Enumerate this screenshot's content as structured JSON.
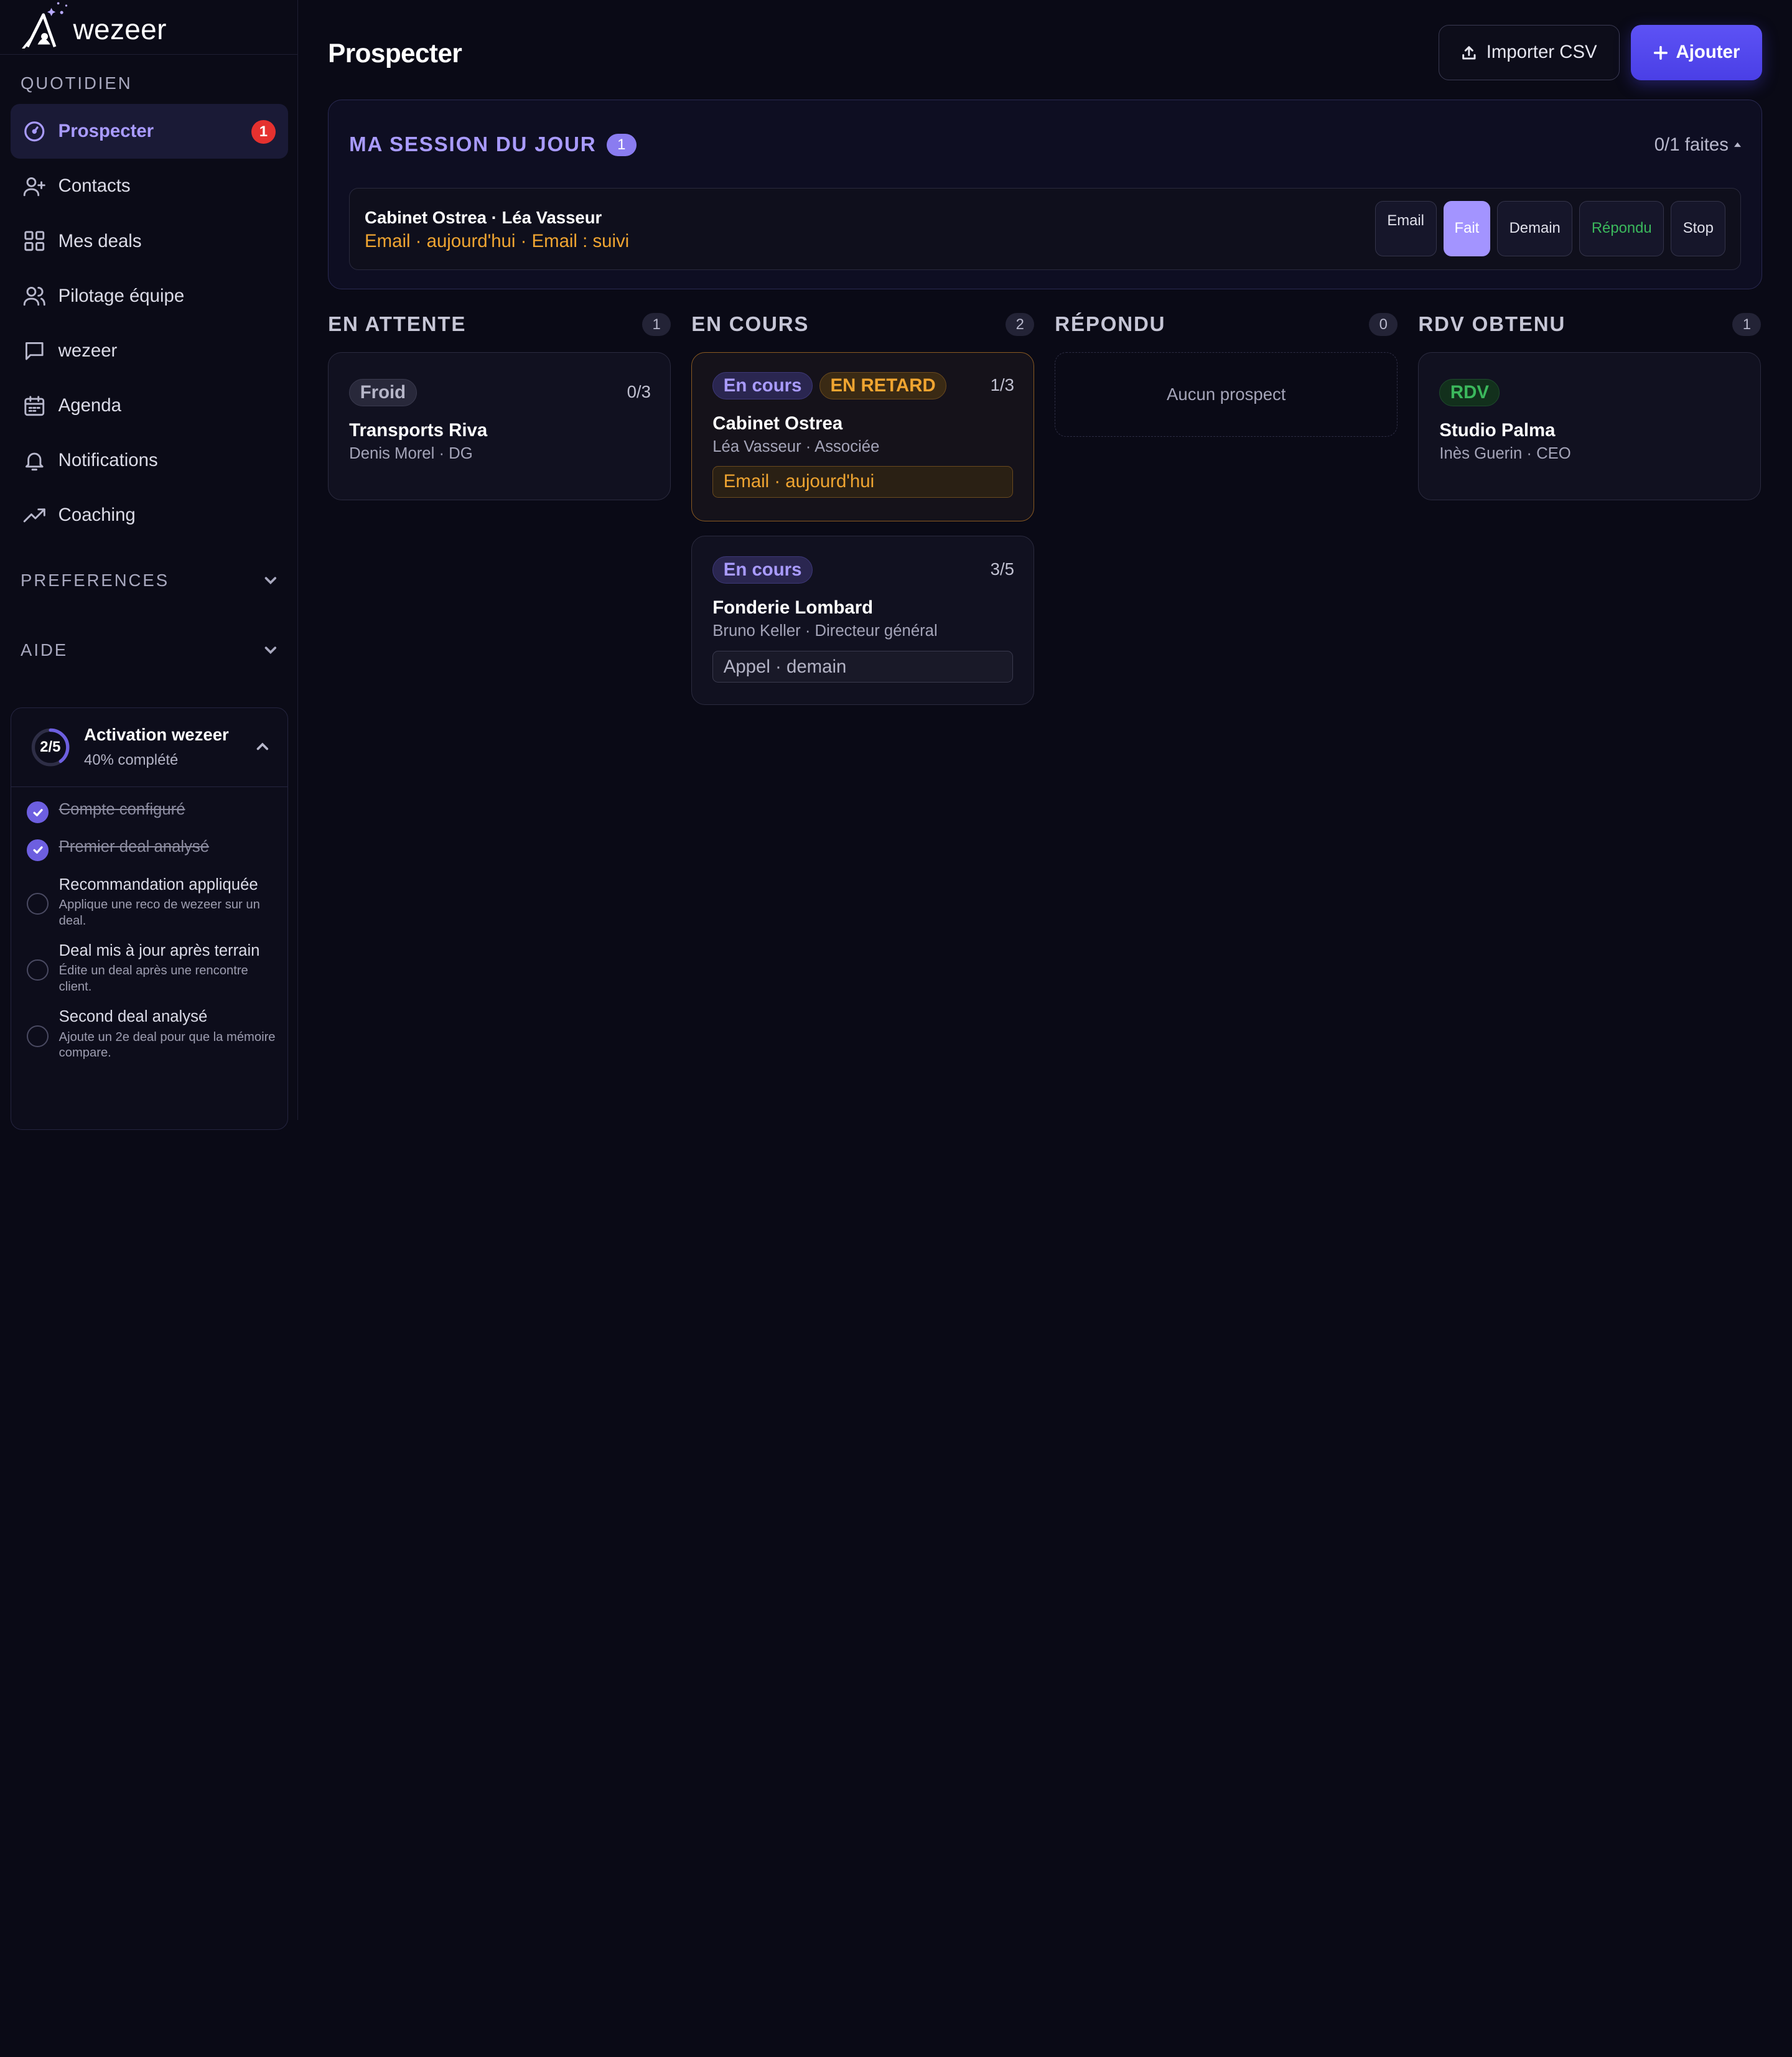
{
  "brand": {
    "name": "wezeer"
  },
  "sidebar": {
    "section_daily": "QUOTIDIEN",
    "items": [
      {
        "label": "Prospecter",
        "icon": "gauge-icon",
        "badge": "1",
        "active": true
      },
      {
        "label": "Contacts",
        "icon": "user-plus-icon"
      },
      {
        "label": "Mes deals",
        "icon": "grid-icon"
      },
      {
        "label": "Pilotage équipe",
        "icon": "users-icon"
      },
      {
        "label": "wezeer",
        "icon": "chat-icon"
      },
      {
        "label": "Agenda",
        "icon": "calendar-icon"
      },
      {
        "label": "Notifications",
        "icon": "bell-icon"
      },
      {
        "label": "Coaching",
        "icon": "trending-up-icon"
      }
    ],
    "section_preferences": "PREFERENCES",
    "section_help": "AIDE"
  },
  "activation": {
    "progress": "2/5",
    "progress_fraction": 0.4,
    "title": "Activation wezeer",
    "subtitle": "40% complété",
    "items": [
      {
        "title": "Compte configuré",
        "done": true
      },
      {
        "title": "Premier deal analysé",
        "done": true
      },
      {
        "title": "Recommandation appliquée",
        "desc": "Applique une reco de wezeer sur un deal.",
        "done": false
      },
      {
        "title": "Deal mis à jour après terrain",
        "desc": "Édite un deal après une rencontre client.",
        "done": false
      },
      {
        "title": "Second deal analysé",
        "desc": "Ajoute un 2e deal pour que la mémoire compare.",
        "done": false
      }
    ]
  },
  "header": {
    "title": "Prospecter",
    "import_label": "Importer CSV",
    "add_label": "Ajouter"
  },
  "session": {
    "title": "MA SESSION DU JOUR",
    "badge": "1",
    "count": "0/1 faites",
    "row": {
      "name": "Cabinet Ostrea · Léa Vasseur",
      "meta": "Email · aujourd'hui · Email : suivi",
      "actions": {
        "email": "Email",
        "done": "Fait",
        "tomorrow": "Demain",
        "replied": "Répondu",
        "stop": "Stop"
      }
    }
  },
  "columns": [
    {
      "title": "EN ATTENTE",
      "count": "1"
    },
    {
      "title": "EN COURS",
      "count": "2"
    },
    {
      "title": "RÉPONDU",
      "count": "0",
      "empty": "Aucun prospect"
    },
    {
      "title": "RDV OBTENU",
      "count": "1"
    }
  ],
  "cards": {
    "transports": {
      "tag": "Froid",
      "steps": "0/3",
      "name": "Transports Riva",
      "contact": "Denis Morel · DG"
    },
    "ostrea": {
      "tag": "En cours",
      "tag_late": "EN RETARD",
      "steps": "1/3",
      "name": "Cabinet Ostrea",
      "contact": "Léa Vasseur · Associée",
      "action": "Email · aujourd'hui"
    },
    "fonderie": {
      "tag": "En cours",
      "steps": "3/5",
      "name": "Fonderie Lombard",
      "contact": "Bruno Keller · Directeur général",
      "action": "Appel · demain"
    },
    "palma": {
      "tag": "RDV",
      "name": "Studio Palma",
      "contact": "Inès Guerin · CEO"
    }
  },
  "colors": {
    "accent": "#a99bff",
    "primary_button": "#5d52f5",
    "warning": "#f0a531",
    "success": "#3bb85c",
    "danger": "#e5312f",
    "background": "#0a0a16"
  }
}
